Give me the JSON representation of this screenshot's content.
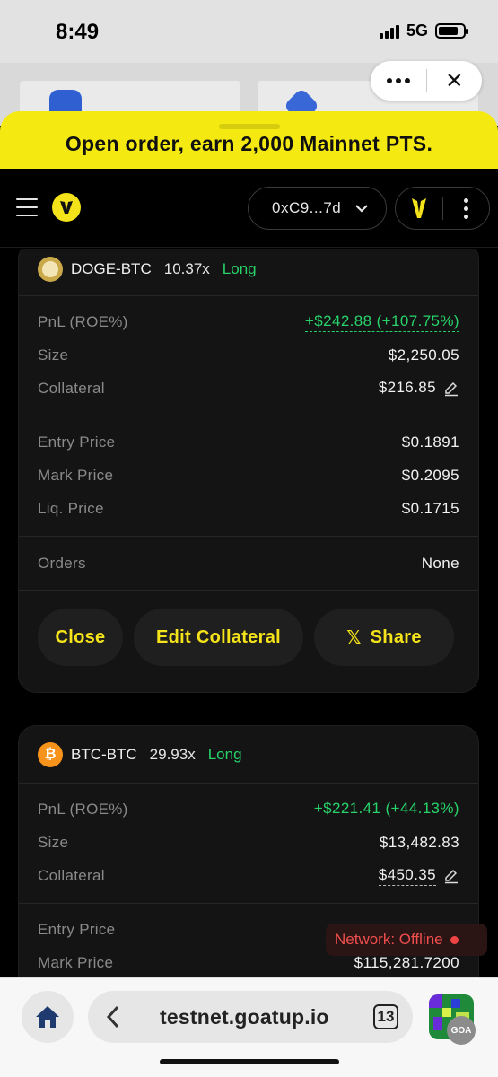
{
  "status_bar": {
    "time": "8:49",
    "network": "5G"
  },
  "banner": {
    "text": "Open order, earn 2,000 Mainnet PTS."
  },
  "header": {
    "wallet_address": "0xC9...7d"
  },
  "positions": [
    {
      "pair": "DOGE-BTC",
      "leverage": "10.37x",
      "side": "Long",
      "coin": "doge",
      "pnl_label": "PnL (ROE%)",
      "pnl_value": "+$242.88 (+107.75%)",
      "size_label": "Size",
      "size_value": "$2,250.05",
      "collateral_label": "Collateral",
      "collateral_value": "$216.85",
      "entry_label": "Entry Price",
      "entry_value": "$0.1891",
      "mark_label": "Mark Price",
      "mark_value": "$0.2095",
      "liq_label": "Liq. Price",
      "liq_value": "$0.1715",
      "orders_label": "Orders",
      "orders_value": "None",
      "actions": {
        "close": "Close",
        "edit": "Edit Collateral",
        "share": "Share"
      }
    },
    {
      "pair": "BTC-BTC",
      "leverage": "29.93x",
      "side": "Long",
      "coin": "btc",
      "pnl_label": "PnL (ROE%)",
      "pnl_value": "+$221.41 (+44.13%)",
      "size_label": "Size",
      "size_value": "$13,482.83",
      "collateral_label": "Collateral",
      "collateral_value": "$450.35",
      "entry_label": "Entry Price",
      "mark_label": "Mark Price",
      "mark_value": "$115,281.7200"
    }
  ],
  "network_status": {
    "text": "Network: Offline"
  },
  "browser": {
    "url": "testnet.goatup.io",
    "tab_count": "13",
    "profile_badge": "GOA"
  },
  "colors": {
    "accent": "#f4e21a",
    "positive": "#28d36a",
    "negative": "#ef4444",
    "background": "#000000",
    "card": "#141414"
  },
  "icons": [
    "menu-icon",
    "logo-icon",
    "chevron-down-icon",
    "brand-icon",
    "kebab-icon",
    "edit-icon",
    "x-icon",
    "home-icon",
    "back-arrow-icon",
    "tabs-icon",
    "doge-icon",
    "btc-icon"
  ]
}
